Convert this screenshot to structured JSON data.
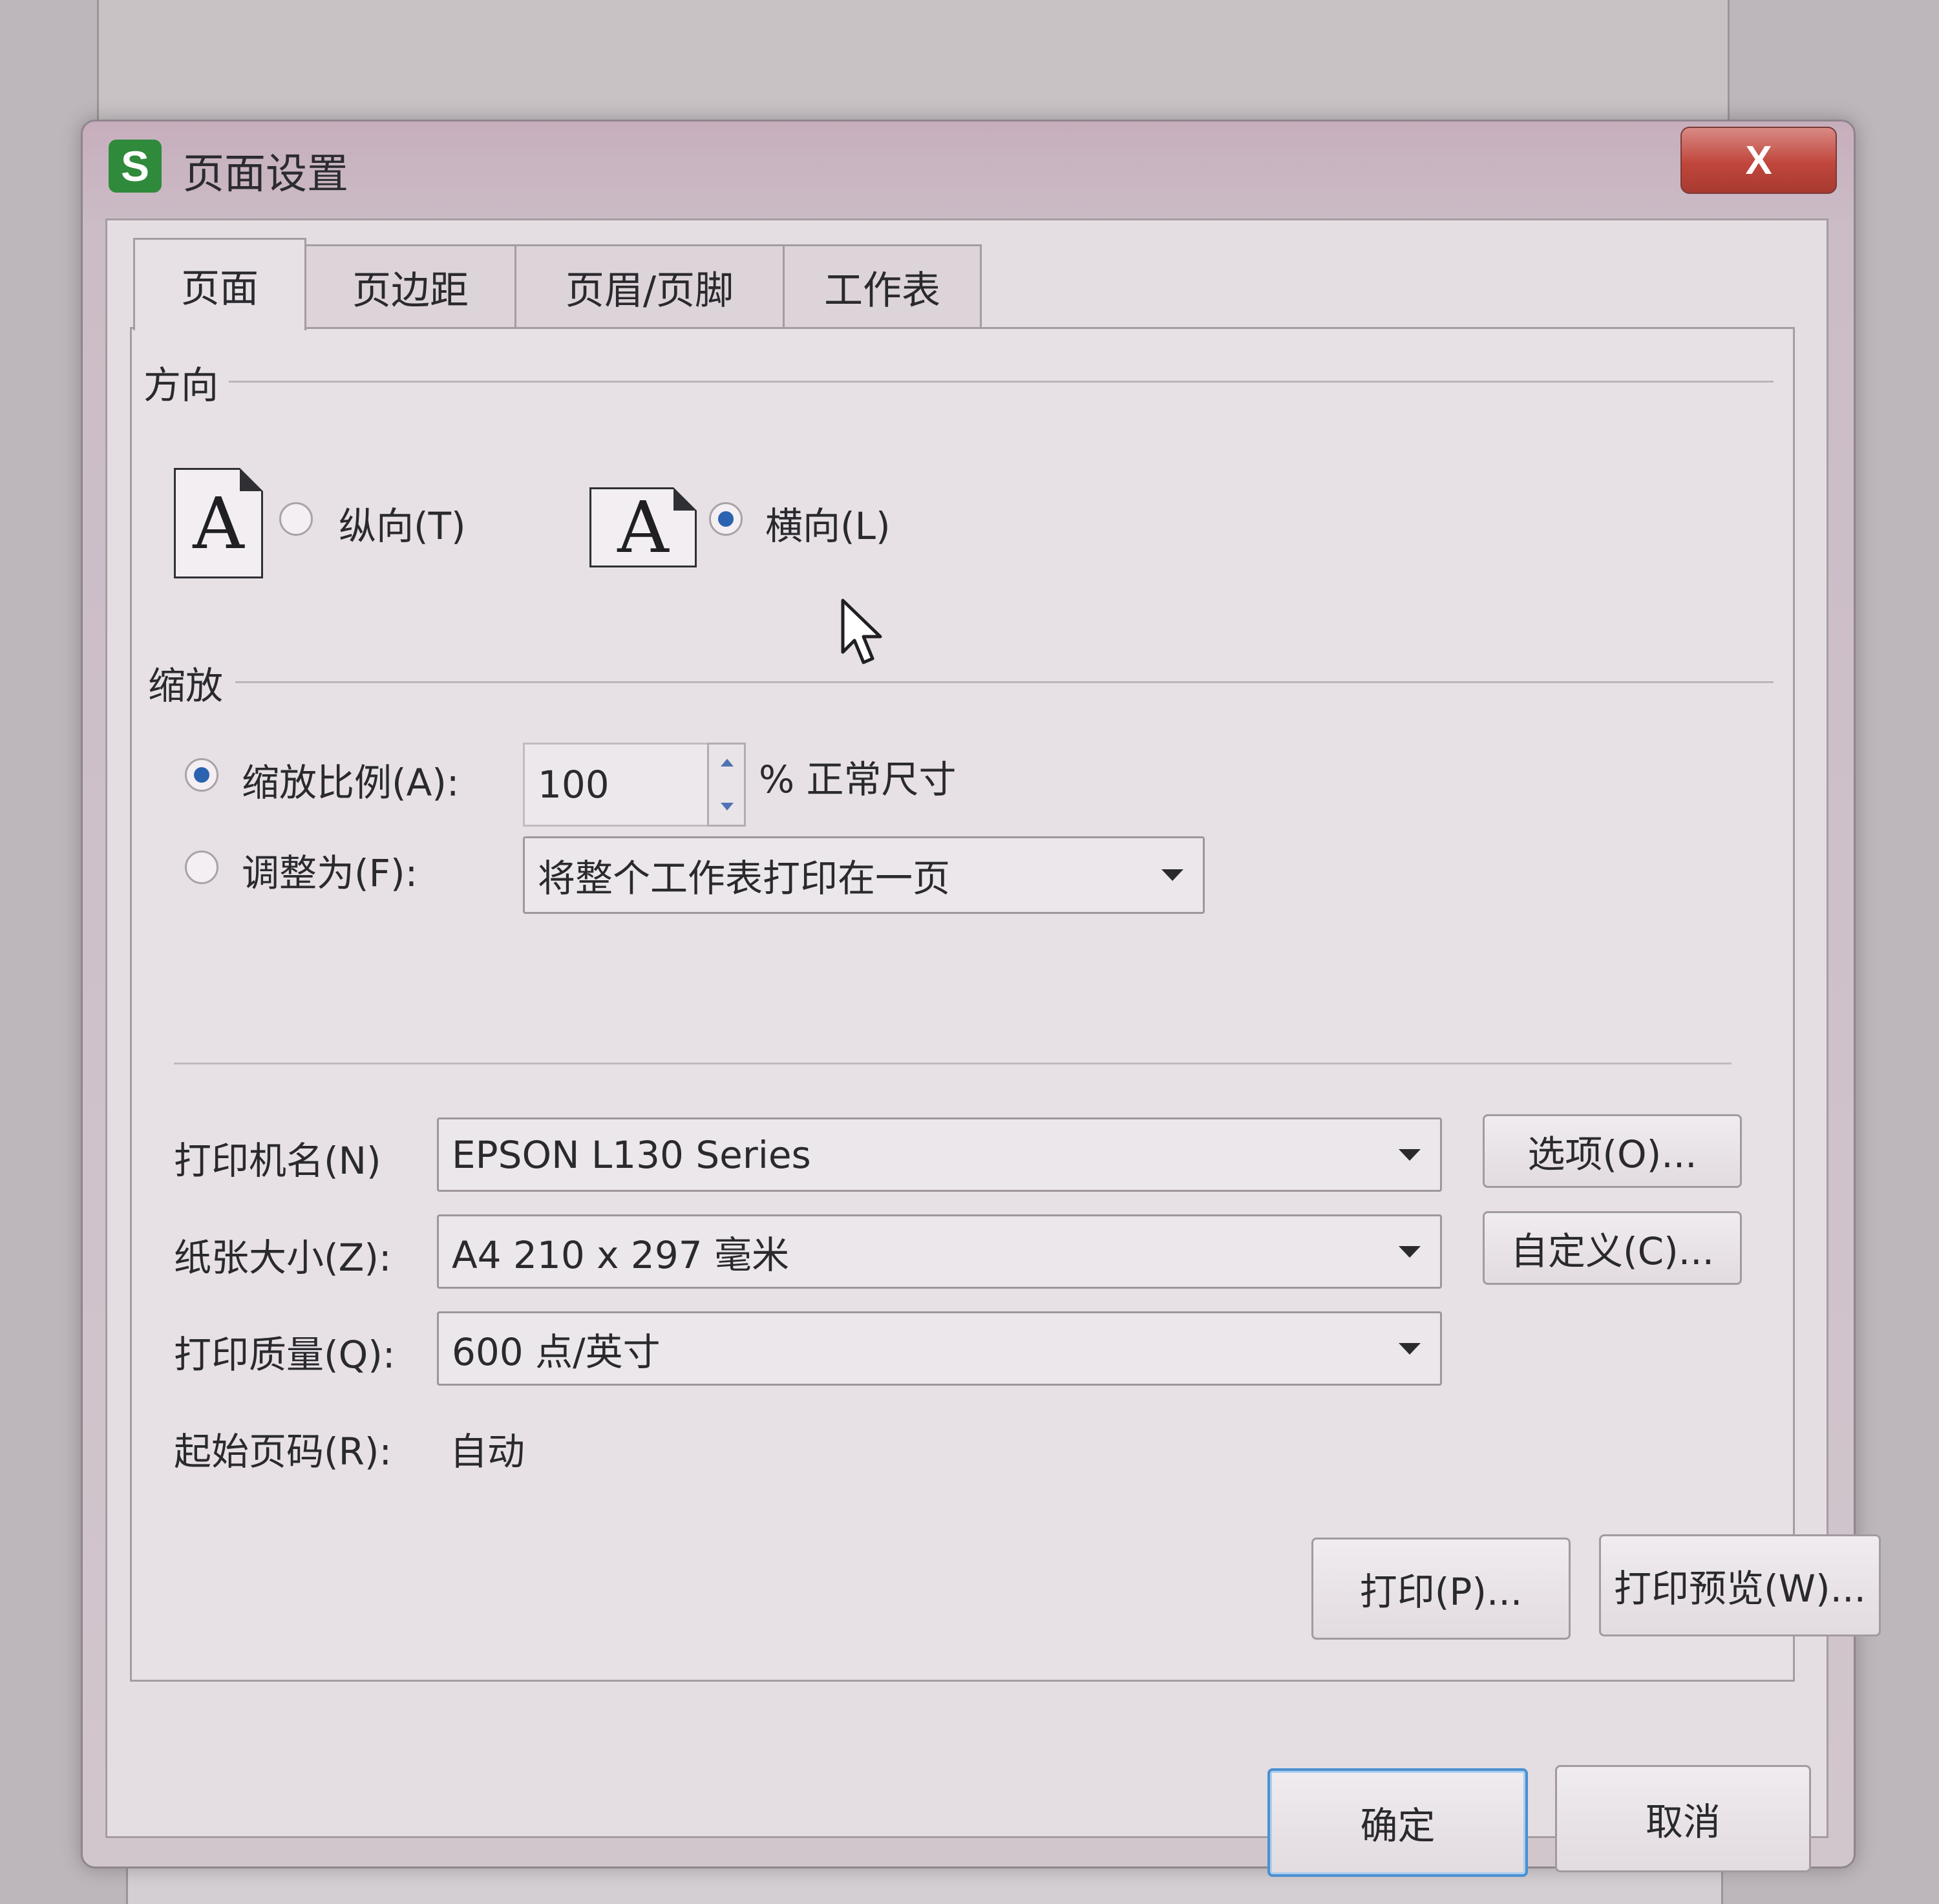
{
  "window": {
    "title": "页面设置",
    "app_icon_letter": "S",
    "close_label": "X"
  },
  "tabs": [
    {
      "label": "页面",
      "active": true
    },
    {
      "label": "页边距",
      "active": false
    },
    {
      "label": "页眉/页脚",
      "active": false
    },
    {
      "label": "工作表",
      "active": false
    }
  ],
  "orientation": {
    "section_label": "方向",
    "portrait_label": "纵向(T)",
    "landscape_label": "横向(L)",
    "selected": "landscape",
    "icon_glyph": "A"
  },
  "scaling": {
    "section_label": "缩放",
    "scale_label": "缩放比例(A):",
    "scale_value": "100",
    "scale_suffix": "% 正常尺寸",
    "fit_label": "调整为(F):",
    "fit_value": "将整个工作表打印在一页",
    "selected": "scale"
  },
  "printer": {
    "name_label": "打印机名(N)",
    "name_value": "EPSON L130 Series",
    "options_button": "选项(O)...",
    "paper_label": "纸张大小(Z):",
    "paper_value": "A4 210 x 297 毫米",
    "custom_button": "自定义(C)...",
    "quality_label": "打印质量(Q):",
    "quality_value": "600 点/英寸",
    "start_page_label": "起始页码(R):",
    "start_page_value": "自动"
  },
  "actions": {
    "print_button": "打印(P)...",
    "preview_button": "打印预览(W)...",
    "ok_button": "确定",
    "cancel_button": "取消"
  },
  "colors": {
    "accent": "#2a63b0",
    "close_red": "#c0463c",
    "app_icon_green": "#2f8a3b"
  }
}
